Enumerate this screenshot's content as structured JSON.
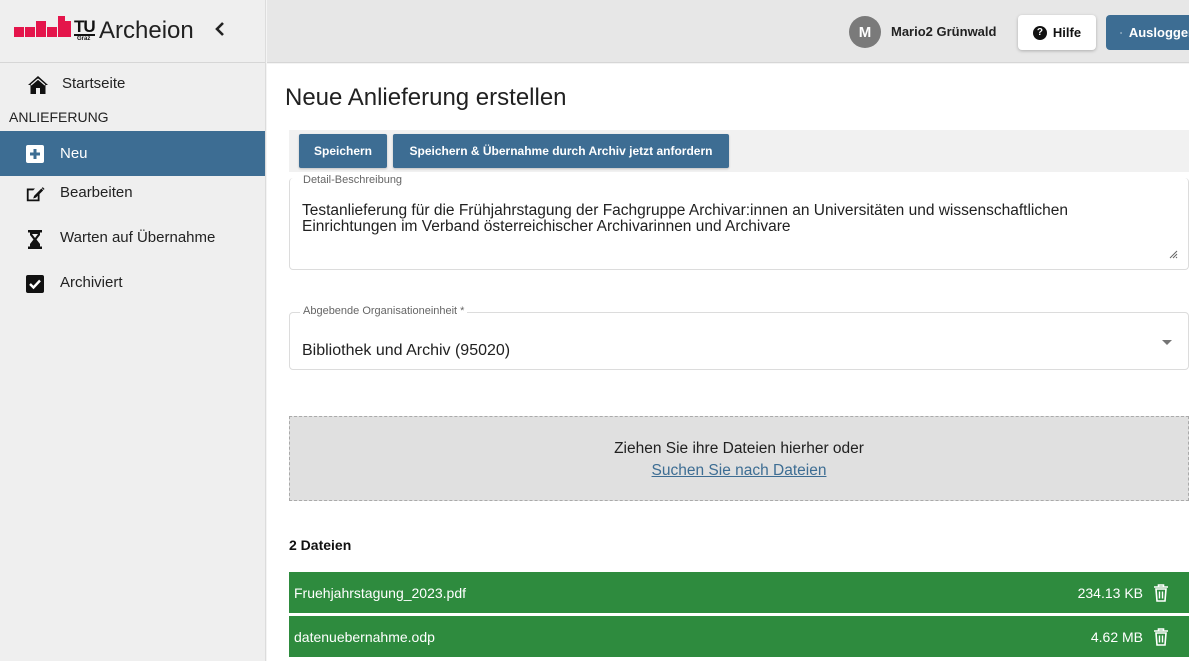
{
  "brand": {
    "title": "Archeion",
    "logo_tu": "TU",
    "logo_graz": "Graz",
    "collapse_glyph": "‹"
  },
  "sidebar": {
    "home_label": "Startseite",
    "section_label": "ANLIEFERUNG",
    "items": [
      {
        "label": "Neu",
        "icon": "plus-square-icon",
        "active": true
      },
      {
        "label": "Bearbeiten",
        "icon": "edit-icon",
        "active": false
      },
      {
        "label": "Warten auf Übernahme",
        "icon": "hourglass-icon",
        "active": false
      },
      {
        "label": "Archiviert",
        "icon": "check-square-icon",
        "active": false
      }
    ]
  },
  "header": {
    "avatar_initial": "M",
    "username": "Mario2 Grünwald",
    "help_label": "Hilfe",
    "logout_label": "Ausloggen"
  },
  "main": {
    "title": "Neue Anlieferung erstellen",
    "save_label": "Speichern",
    "save_request_label": "Speichern & Übernahme durch Archiv jetzt anfordern",
    "description": {
      "label": "Detail-Beschreibung",
      "value": "Testanlieferung für die Frühjahrstagung der Fachgruppe Archivar:innen an Universitäten und wissenschaftlichen Einrichtungen im Verband österreichischer Archivarinnen und Archivare"
    },
    "org_unit": {
      "label": "Abgebende Organisationeinheit *",
      "value": "Bibliothek und Archiv (95020)"
    },
    "dropzone": {
      "text": "Ziehen Sie ihre Dateien hierher oder",
      "link": "Suchen Sie nach Dateien"
    },
    "files_count": "2 Dateien",
    "files": [
      {
        "name": "Fruehjahrstagung_2023.pdf",
        "size": "234.13 KB"
      },
      {
        "name": "datenuebernahme.odp",
        "size": "4.62 MB"
      }
    ]
  },
  "colors": {
    "primary": "#3d6d93",
    "success": "#2e8b3e",
    "logo_red": "#e4154b"
  }
}
